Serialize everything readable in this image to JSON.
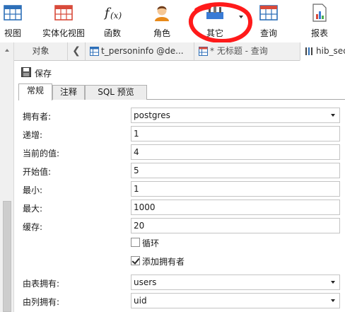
{
  "toolbar": {
    "view": "视图",
    "materialized_view": "实体化视图",
    "function": "函数",
    "role": "角色",
    "other": "其它",
    "query": "查询",
    "report": "报表"
  },
  "tabs": {
    "objects": "对象",
    "tab1": "t_personinfo @de...",
    "tab2": "* 无标题 - 查询",
    "tab3": "hib_seq"
  },
  "save": {
    "label": "保存"
  },
  "subtabs": {
    "general": "常规",
    "comment": "注释",
    "sql_preview": "SQL 预览"
  },
  "form": {
    "owner_label": "拥有者:",
    "owner_value": "postgres",
    "increment_label": "递增:",
    "increment_value": "1",
    "current_label": "当前的值:",
    "current_value": "4",
    "start_label": "开始值:",
    "start_value": "5",
    "min_label": "最小:",
    "min_value": "1",
    "max_label": "最大:",
    "max_value": "1000",
    "cache_label": "缓存:",
    "cache_value": "20",
    "cycle_label": "循环",
    "cycle_checked": false,
    "add_owner_label": "添加拥有者",
    "add_owner_checked": true,
    "owned_by_table_label": "由表拥有:",
    "owned_by_table_value": "users",
    "owned_by_column_label": "由列拥有:",
    "owned_by_column_value": "uid"
  },
  "colors": {
    "annotation_circle": "#ff1a1a",
    "accent_blue": "#3a7bd5"
  }
}
